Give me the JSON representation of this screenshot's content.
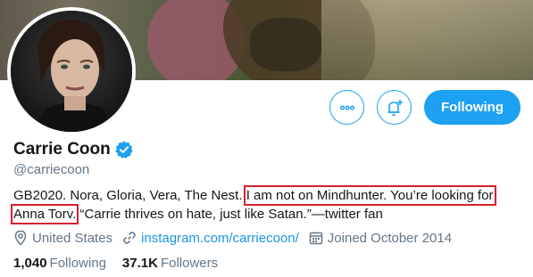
{
  "profile": {
    "name": "Carrie Coon",
    "handle": "@carriecoon",
    "verified": true,
    "bio": {
      "part1": "GB2020. Nora, Gloria, Vera, The Nest. ",
      "highlight1": "I am not on Mindhunter. You’re looking for",
      "highlight2": "Anna Torv.",
      "part2": " “Carrie thrives on hate, just like Satan.”—twitter fan"
    },
    "location": "United States",
    "website": "instagram.com/carriecoon/",
    "joined": "Joined October 2014"
  },
  "stats": {
    "following_count": "1,040",
    "following_label": "Following",
    "followers_count": "37.1K",
    "followers_label": "Followers"
  },
  "actions": {
    "follow_label": "Following",
    "more_icon": "more-icon",
    "notify_icon": "bell-plus-icon"
  },
  "colors": {
    "accent": "#1da1f2",
    "link": "#1b95e0",
    "highlight_box": "#d6202e",
    "muted": "#657786"
  }
}
